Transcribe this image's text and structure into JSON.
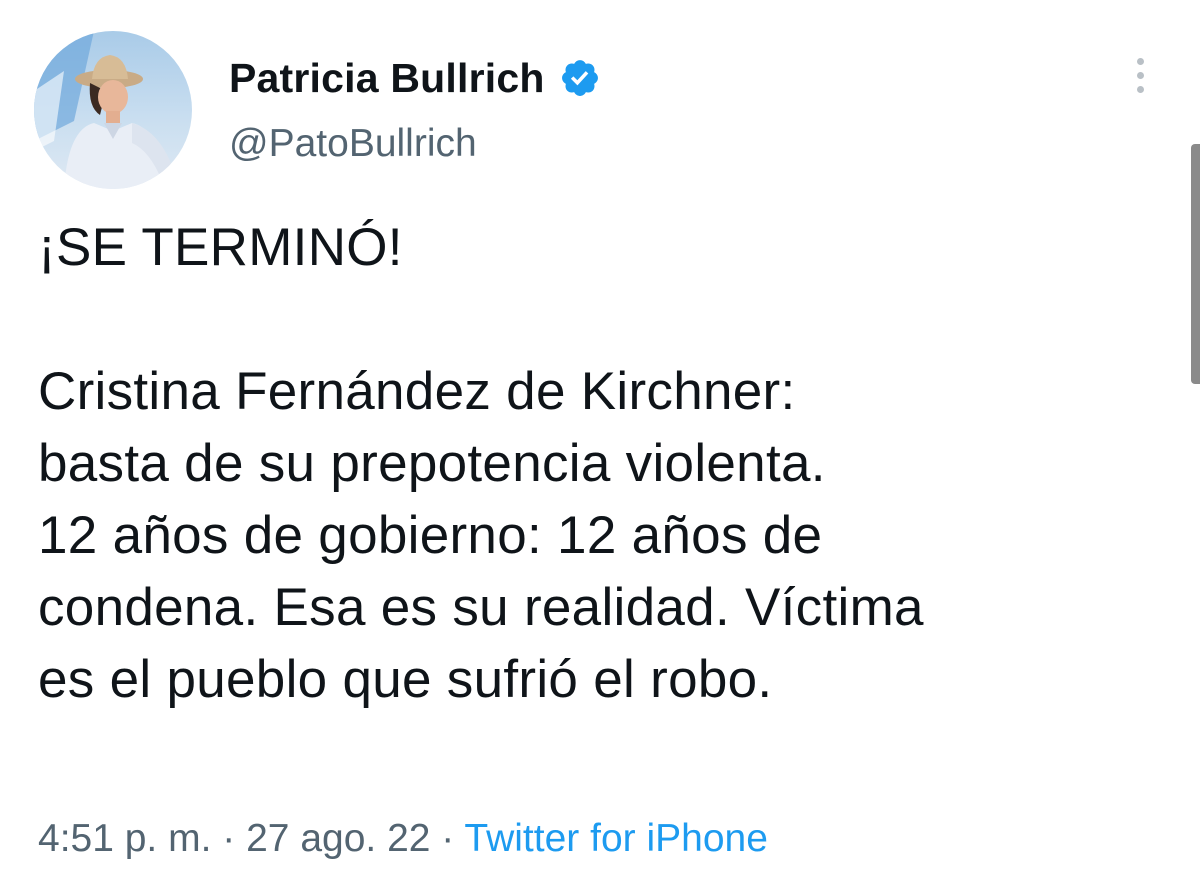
{
  "author": {
    "display_name": "Patricia Bullrich",
    "handle": "@PatoBullrich",
    "verified": true,
    "avatar_icon": "profile-photo"
  },
  "tweet": {
    "text": "¡SE TERMINÓ!\n\nCristina Fernández de Kirchner:\nbasta de su prepotencia violenta.\n12 años de gobierno: 12 años de\ncondena. Esa es su realidad. Víctima\nes el pueblo que sufrió el robo."
  },
  "meta": {
    "time": "4:51 p. m.",
    "separator": " · ",
    "date": "27 ago. 22",
    "source": "Twitter for iPhone"
  },
  "colors": {
    "text": "#0f1419",
    "secondary": "#536471",
    "accent": "#1d9bf0"
  }
}
